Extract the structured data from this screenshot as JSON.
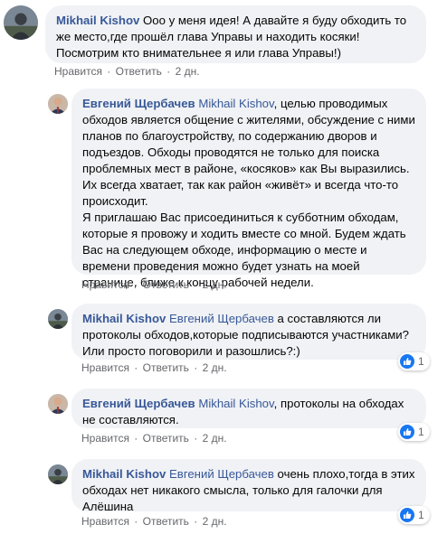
{
  "comments": [
    {
      "author": "Mikhail Kishov",
      "mention": "",
      "text": " Ооо у меня идея! А давайте я буду обходить то же место,где прошёл глава Управы и находить косяки! Посмотрим кто внимательнее я или глава Управы!)",
      "text2": "",
      "like": "Нравится",
      "reply": "Ответить",
      "time": "2 дн.",
      "reactions": ""
    },
    {
      "author": "Евгений Щербачев",
      "mention": "Mikhail Kishov",
      "text": ", целью проводимых обходов является общение с жителями, обсуждение с ними планов по благоустройству, по содержанию дворов и подъездов. Обходы проводятся не только для поиска проблемных мест в районе, «косяков» как Вы выразились. Их всегда хватает, так как район «живёт» и всегда что-то происходит.",
      "text2": "Я приглашаю Вас присоединиться к субботним обходам, которые я провожу и ходить вместе со мной. Будем ждать Вас на следующем обходе, информацию о месте и времени проведения можно будет узнать на моей странице, ближе к концу рабочей недели.",
      "like": "Нравится",
      "reply": "Ответить",
      "time": "2 дн.",
      "reactions": ""
    },
    {
      "author": "Mikhail Kishov",
      "mention": "Евгений Щербачев",
      "text": " а составляются ли протоколы обходов,которые подписываются участниками? Или просто поговорили и разошлись?:)",
      "text2": "",
      "like": "Нравится",
      "reply": "Ответить",
      "time": "2 дн.",
      "reactions": "1"
    },
    {
      "author": "Евгений Щербачев",
      "mention": "Mikhail Kishov",
      "text": ", протоколы на обходах не составляются.",
      "text2": "",
      "like": "Нравится",
      "reply": "Ответить",
      "time": "2 дн.",
      "reactions": "1"
    },
    {
      "author": "Mikhail Kishov",
      "mention": "Евгений Щербачев",
      "text": " очень плохо,тогда в этих обходах нет никакого смысла, только для галочки для Алёшина",
      "text2": "",
      "like": "Нравится",
      "reply": "Ответить",
      "time": "2 дн.",
      "reactions": "1"
    }
  ],
  "colors": {
    "link": "#385898",
    "bubble": "#f0f2f5",
    "meta": "#65676b",
    "like": "#1877f2"
  },
  "icons": {
    "reaction": "like-thumb-icon"
  }
}
